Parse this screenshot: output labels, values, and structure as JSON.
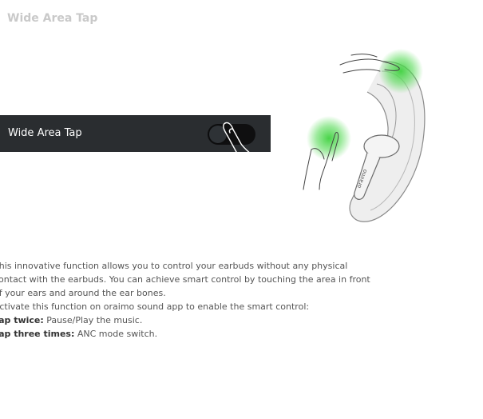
{
  "header": {
    "title": "Wide Area Tap"
  },
  "toggle": {
    "label": "Wide Area Tap",
    "state": "off"
  },
  "description": {
    "line1": "This innovative function allows you to control your earbuds without any physical",
    "line2": "contact with the earbuds. You can achieve smart control by touching the area in front",
    "line3": "of your ears and around the ear bones.",
    "line4": "Activate this function on oraimo sound app to enable the smart control:",
    "item1_label": "Tap twice:",
    "item1_text": " Pause/Play the music.",
    "item2_label": "Tap three times:",
    "item2_text": " ANC mode switch."
  },
  "earbud": {
    "brand": "oraimo"
  },
  "colors": {
    "bar": "#2a2d30",
    "highlight": "#3fd13f"
  }
}
